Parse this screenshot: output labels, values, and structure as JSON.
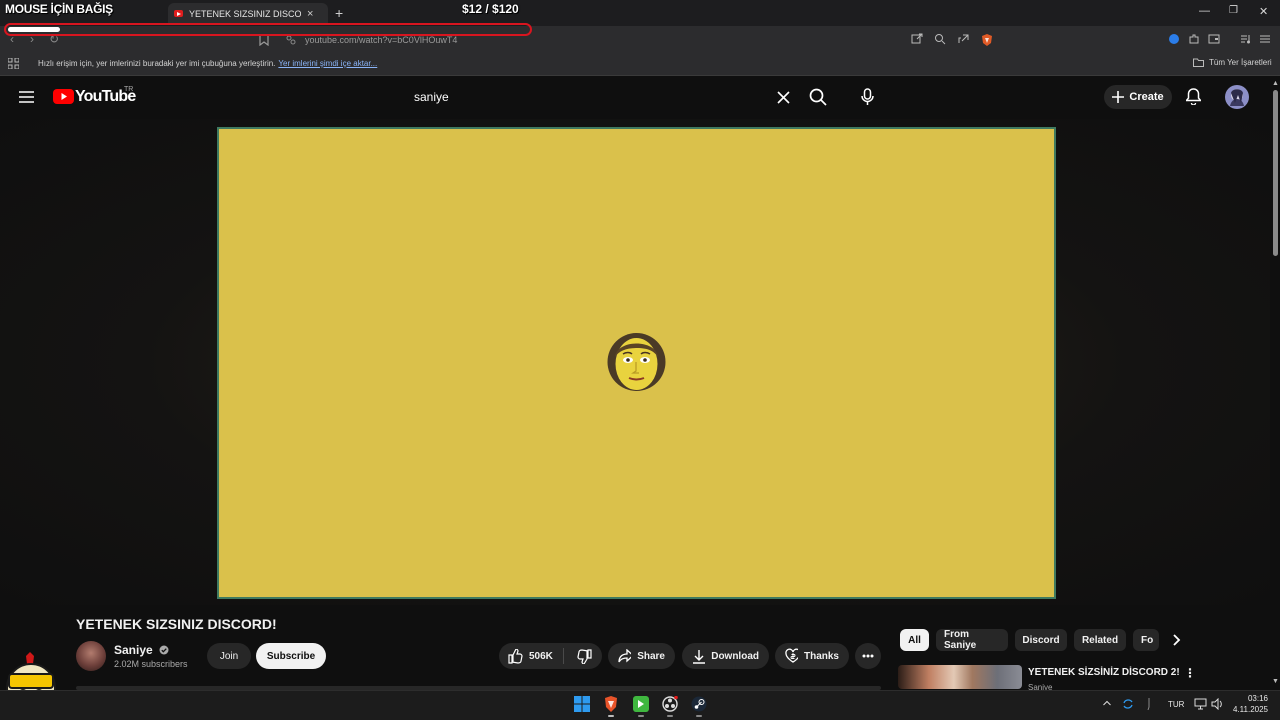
{
  "overlay": {
    "donation_title": "MOUSE İÇİN BAĞIŞ",
    "donation_amount": "$12  / $120",
    "donation_progress": 0.1
  },
  "browser": {
    "tab_title": "YETENEK SIZSINIZ DISCORD! - Y",
    "url": "youtube.com/watch?v=bC0VlHOuwT4",
    "bookmark_prompt": "Hızlı erişim için, yer imlerinizi buradaki yer imi çubuğuna yerleştirin.",
    "bookmark_import_link": "Yer imlerini şimdi içe aktar...",
    "all_bookmarks": "Tüm Yer İşaretleri"
  },
  "youtube": {
    "logo": "YouTube",
    "region": "TR",
    "search_value": "saniye",
    "create_label": "Create"
  },
  "video": {
    "title": "YETENEK SIZSINIZ DISCORD!",
    "channel": "Saniye",
    "subscribers": "2.02M subscribers",
    "join_label": "Join",
    "subscribe_label": "Subscribe",
    "likes": "506K",
    "share_label": "Share",
    "download_label": "Download",
    "thanks_label": "Thanks",
    "player_bg": "#dac14b"
  },
  "chips": [
    "All",
    "From Saniye",
    "Discord",
    "Related",
    "Fo"
  ],
  "related": {
    "title": "YETENEK SİZSİNİZ DİSCORD 2!",
    "channel": "Saniye"
  },
  "taskbar": {
    "lang": "TUR",
    "time": "03:16",
    "date": "4.11.2025"
  }
}
